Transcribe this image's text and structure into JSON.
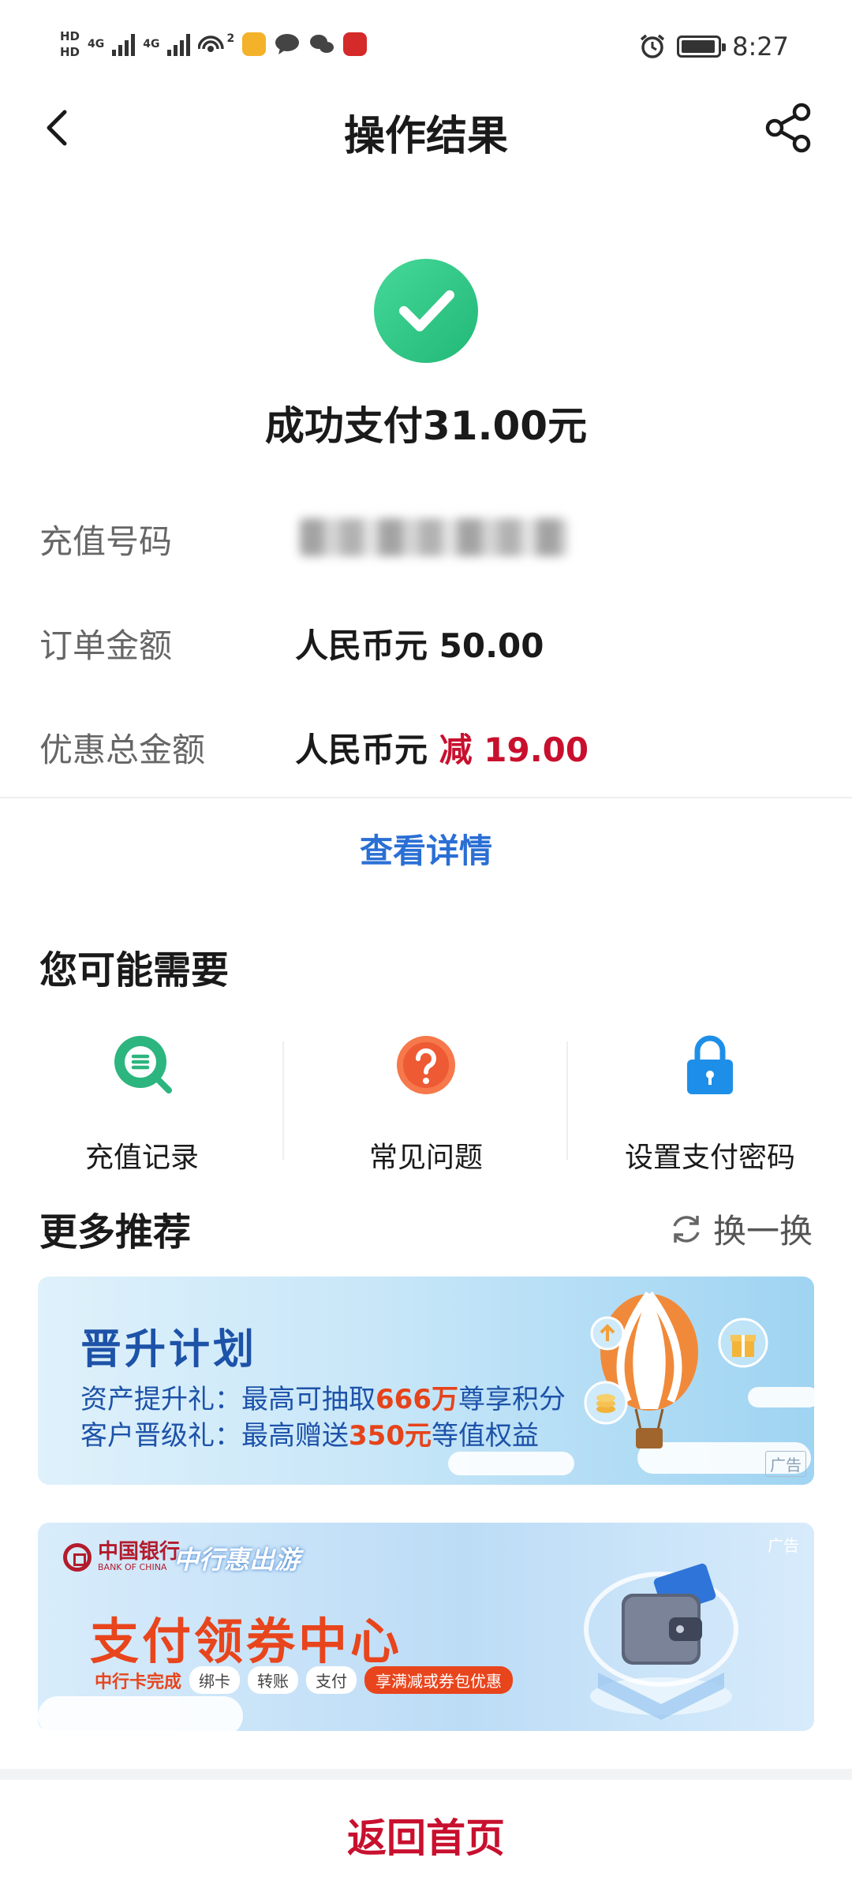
{
  "status_bar": {
    "sim1": "HD",
    "sim2": "HD",
    "network1": "4G",
    "network2": "4G",
    "hotspot_count": "2",
    "time": "8:27"
  },
  "nav": {
    "title": "操作结果"
  },
  "result": {
    "message": "成功支付31.00元"
  },
  "details": {
    "recharge_number_label": "充值号码",
    "order_amount_label": "订单金额",
    "order_amount_value": "人民币元 50.00",
    "discount_label": "优惠总金额",
    "discount_currency": "人民币元 ",
    "discount_value": "减 19.00"
  },
  "view_details": "查看详情",
  "maybe_need": {
    "title": "您可能需要",
    "items": [
      {
        "label": "充值记录",
        "icon": "search-list-icon"
      },
      {
        "label": "常见问题",
        "icon": "question-icon"
      },
      {
        "label": "设置支付密码",
        "icon": "lock-icon"
      }
    ]
  },
  "more": {
    "title": "更多推荐",
    "refresh_label": "换一换"
  },
  "banner1": {
    "title": "晋升计划",
    "line1_prefix": "资产提升礼：最高可抽取",
    "line1_highlight": "666万",
    "line1_suffix": "尊享积分",
    "line2_prefix": "客户晋级礼：最高赠送",
    "line2_highlight": "350元",
    "line2_suffix": "等值权益",
    "ad_tag": "广告"
  },
  "banner2": {
    "bank_name": "中国银行",
    "bank_name_en": "BANK OF CHINA",
    "brand": "中行惠出游",
    "title": "支付领券中心",
    "lead": "中行卡完成",
    "pills": [
      "绑卡",
      "转账",
      "支付"
    ],
    "promo": "享满减或券包优惠",
    "ad_tag": "广告"
  },
  "footer": {
    "home_button": "返回首页"
  },
  "colors": {
    "accent_blue": "#2a6fd4",
    "brand_red": "#c8102e",
    "success_green": "#22b876"
  }
}
